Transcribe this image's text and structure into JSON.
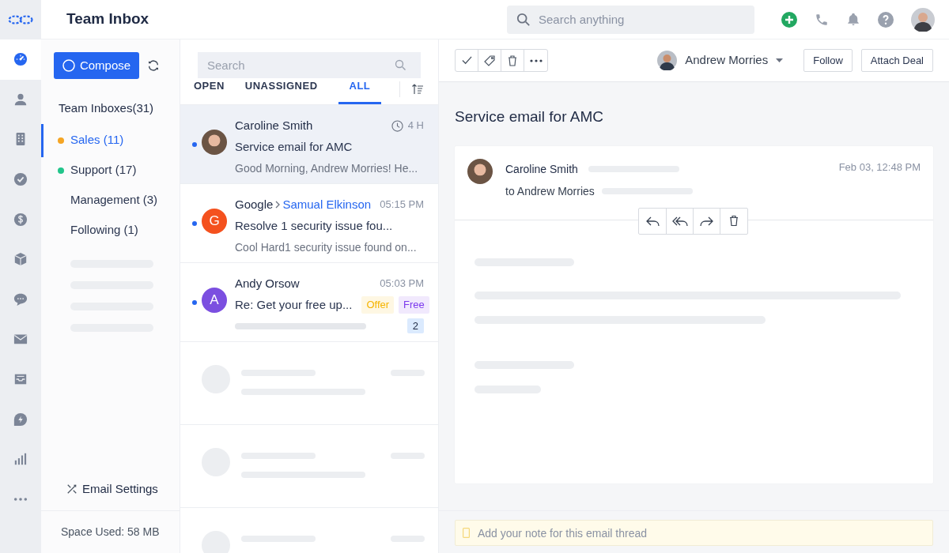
{
  "app": {
    "title": "Team Inbox",
    "search": {
      "placeholder": "Search anything"
    }
  },
  "rail": [
    {
      "selected": true
    },
    {
      "selected": false
    },
    {
      "selected": false
    },
    {
      "selected": false
    },
    {
      "selected": false
    },
    {
      "selected": false
    },
    {
      "selected": false
    },
    {
      "selected": false
    },
    {
      "selected": false
    },
    {
      "selected": false
    },
    {
      "selected": false
    },
    {
      "selected": false
    }
  ],
  "sidebar": {
    "compose": "Compose",
    "heading": "Team Inboxes(31)",
    "folders": [
      {
        "label": "Sales (11)",
        "selected": true,
        "color": "#f5a524"
      },
      {
        "label": "Support (17)",
        "selected": false,
        "color": "#22c58b"
      },
      {
        "label": "Management (3)",
        "selected": false
      },
      {
        "label": "Following (1)",
        "selected": false
      }
    ],
    "settings": "Email Settings",
    "space_used": "Space Used: 58 MB"
  },
  "list": {
    "search": {
      "placeholder": "Search"
    },
    "tabs": [
      {
        "label": "OPEN",
        "selected": false
      },
      {
        "label": "UNASSIGNED",
        "selected": false
      },
      {
        "label": "ALL",
        "selected": true
      }
    ],
    "conversations": [
      {
        "sender": "Caroline Smith",
        "time": "4 H",
        "clock": true,
        "subject": "Service email for AMC",
        "preview": "Good Morning, Andrew Morries! He...",
        "unread": true,
        "selected": true,
        "avatar": {
          "kind": "photo"
        }
      },
      {
        "sender": "Google",
        "via": "Samual Elkinson",
        "time": "05:15 PM",
        "subject": "Resolve 1 security issue fou...",
        "preview": "Cool Hard1 security issue found on...",
        "unread": true,
        "selected": false,
        "avatar": {
          "kind": "letter",
          "letter": "G",
          "color": "#f4511e"
        }
      },
      {
        "sender": "Andy Orsow",
        "time": "05:03 PM",
        "subject": "Re: Get your free up...",
        "unread": true,
        "selected": false,
        "avatar": {
          "kind": "letter",
          "letter": "A",
          "color": "#7b4fe0"
        },
        "tags": [
          {
            "label": "Offer",
            "color": "#f5b400"
          },
          {
            "label": "Free",
            "color": "#7c3aed"
          }
        ],
        "count": "2"
      }
    ]
  },
  "detail": {
    "assignee": "Andrew Morries",
    "buttons": [
      "Follow",
      "Attach Deal"
    ],
    "subject": "Service email for AMC",
    "message": {
      "sender": "Caroline Smith",
      "to": "to Andrew Morries",
      "date": "Feb 03, 12:48 PM"
    },
    "note": {
      "placeholder": "Add your note for this email thread"
    }
  }
}
